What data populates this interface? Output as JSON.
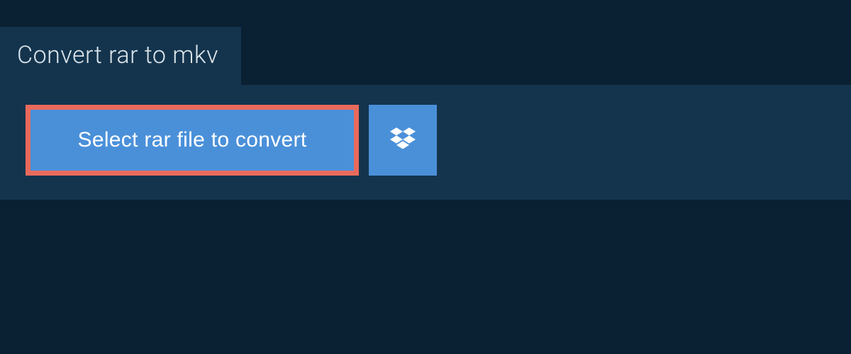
{
  "tab": {
    "title": "Convert rar to mkv"
  },
  "actions": {
    "select_file_label": "Select rar file to convert",
    "dropbox_icon_name": "dropbox-icon"
  },
  "colors": {
    "page_bg": "#0a2133",
    "panel_bg": "#14344e",
    "button_bg": "#4a90d9",
    "highlight_border": "#e96a5c",
    "text_light": "#dce5ea"
  }
}
